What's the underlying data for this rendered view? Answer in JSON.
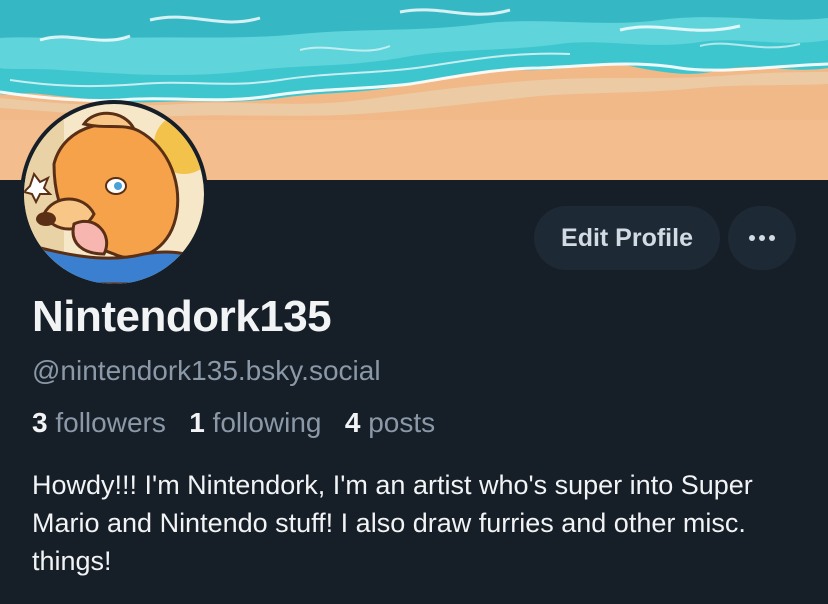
{
  "profile": {
    "display_name": "Nintendork135",
    "handle": "@nintendork135.bsky.social",
    "bio": "Howdy!!! I'm Nintendork, I'm an artist who's super into Super Mario and Nintendo stuff! I also draw furries and other misc. things!"
  },
  "stats": {
    "followers_count": "3",
    "followers_label": "followers",
    "following_count": "1",
    "following_label": "following",
    "posts_count": "4",
    "posts_label": "posts"
  },
  "actions": {
    "edit_profile_label": "Edit Profile",
    "more_icon": "ellipsis-icon"
  },
  "banner": {
    "description_icon": "beach-banner-image"
  },
  "colors": {
    "background": "#161e27",
    "button_bg": "#1e2936",
    "text_primary": "#f1f3f5",
    "text_secondary": "#8a98a8",
    "sea": "#3ec6cf",
    "sand": "#f1b888"
  }
}
